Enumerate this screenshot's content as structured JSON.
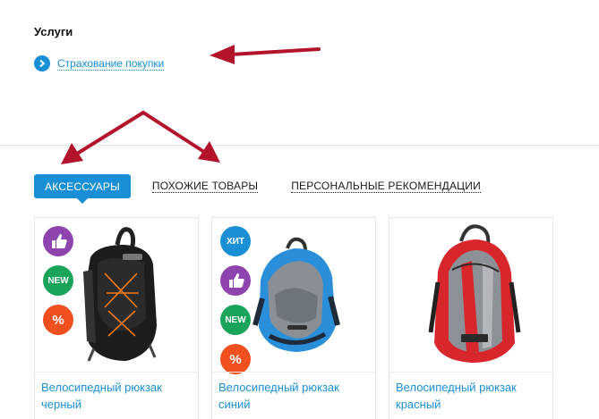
{
  "services": {
    "title": "Услуги",
    "link_label": "Страхование покупки"
  },
  "tabs": [
    {
      "label": "АКСЕССУАРЫ",
      "active": true
    },
    {
      "label": "ПОХОЖИЕ ТОВАРЫ",
      "active": false
    },
    {
      "label": "ПЕРСОНАЛЬНЫЕ РЕКОМЕНДАЦИИ",
      "active": false
    }
  ],
  "products": [
    {
      "name": "Велосипедный рюкзак черный",
      "badges": [
        "like",
        "new",
        "percent"
      ]
    },
    {
      "name": "Велосипедный рюкзак синий",
      "badges": [
        "hit",
        "like",
        "new",
        "percent"
      ]
    },
    {
      "name": "Велосипедный рюкзак красный",
      "badges": []
    }
  ],
  "badges": {
    "hit_label": "ХИТ",
    "new_label": "NEW",
    "percent_label": "%"
  },
  "colors": {
    "accent": "#1a8fd6",
    "arrow": "#b3132b",
    "badge_purple": "#8e44ad",
    "badge_green": "#1aa35a",
    "badge_orange": "#f0501e"
  }
}
